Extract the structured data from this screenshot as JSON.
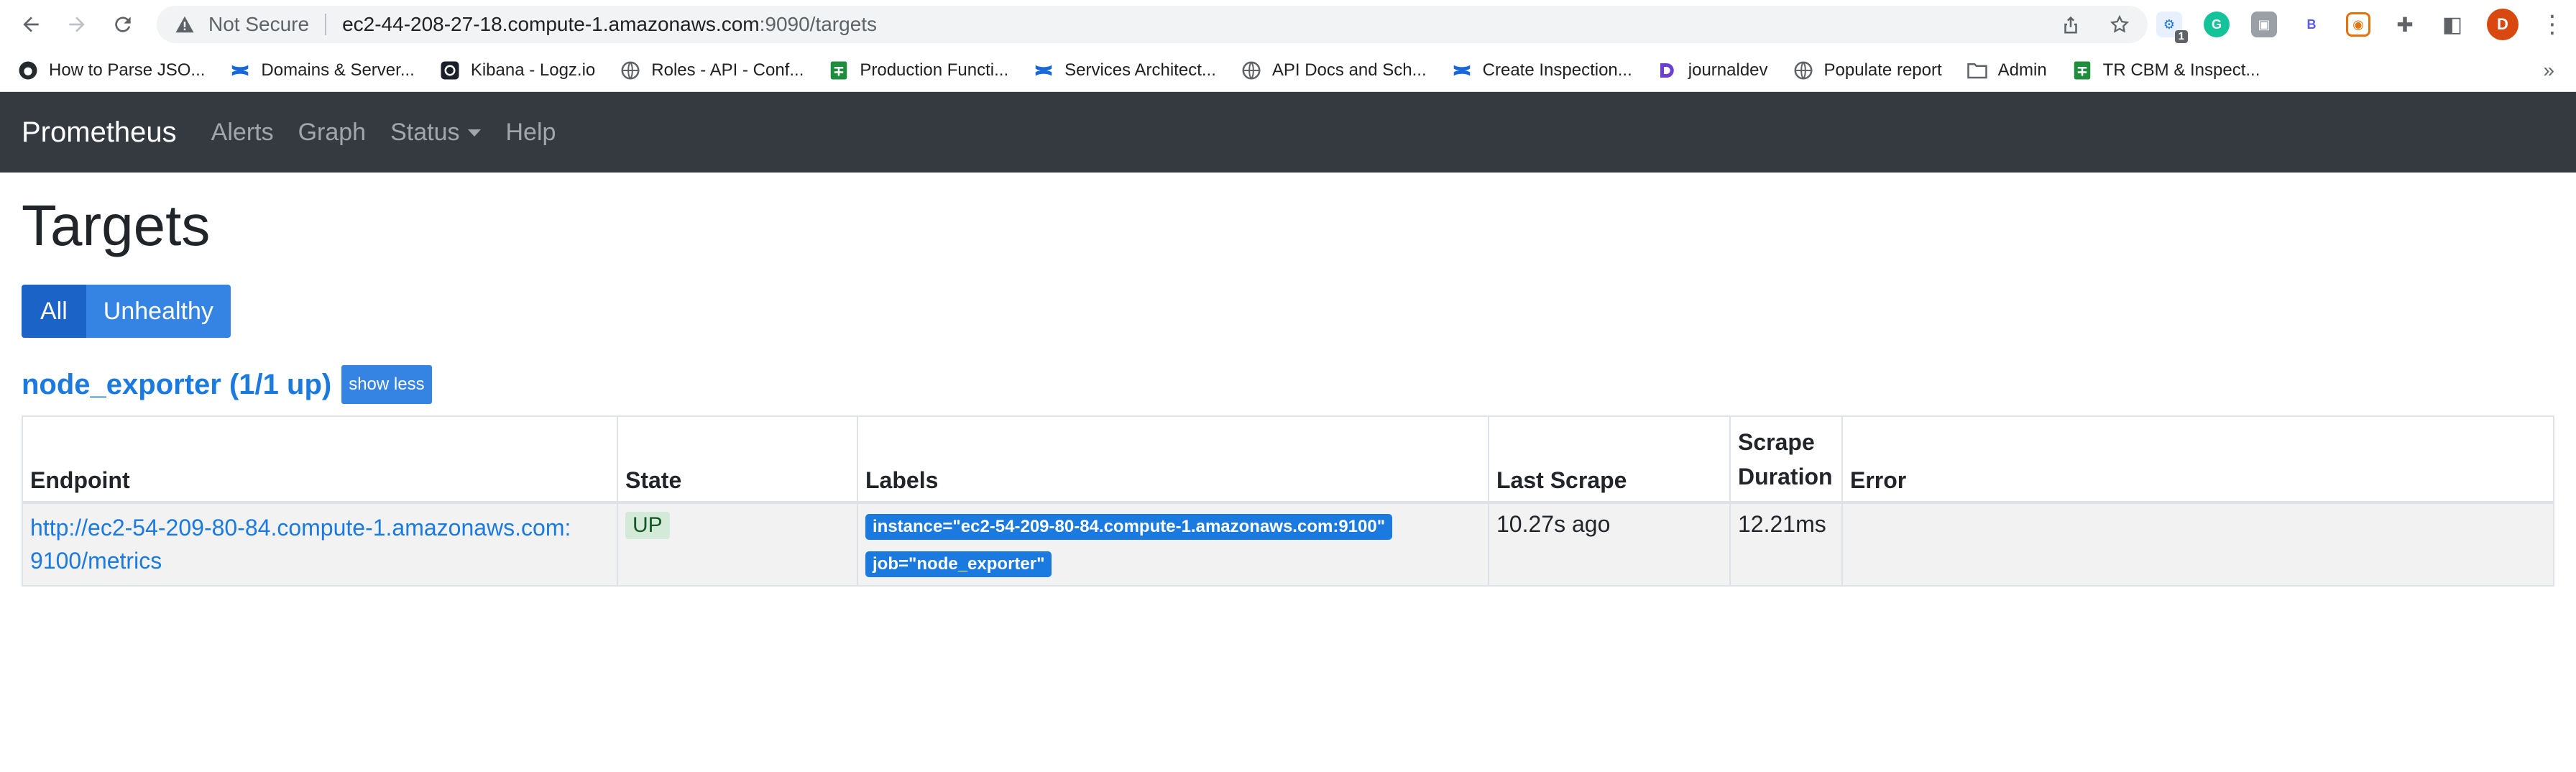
{
  "browser": {
    "security_label": "Not Secure",
    "url_host": "ec2-44-208-27-18.compute-1.amazonaws.com",
    "url_rest": ":9090/targets",
    "profile_initial": "D",
    "extension_badge": "1",
    "bookmarks": [
      {
        "label": "How to Parse JSO...",
        "icon": "github-icon"
      },
      {
        "label": "Domains & Server...",
        "icon": "confluence-icon"
      },
      {
        "label": "Kibana - Logz.io",
        "icon": "logzio-icon"
      },
      {
        "label": "Roles - API - Conf...",
        "icon": "globe-icon"
      },
      {
        "label": "Production Functi...",
        "icon": "sheets-icon"
      },
      {
        "label": "Services Architect...",
        "icon": "confluence-icon"
      },
      {
        "label": "API Docs and Sch...",
        "icon": "globe-icon"
      },
      {
        "label": "Create Inspection...",
        "icon": "confluence-icon"
      },
      {
        "label": "journaldev",
        "icon": "journaldev-icon"
      },
      {
        "label": "Populate report",
        "icon": "globe-icon"
      },
      {
        "label": "Admin",
        "icon": "folder-icon"
      },
      {
        "label": "TR CBM & Inspect...",
        "icon": "sheets-icon"
      }
    ],
    "more_label": "»"
  },
  "navbar": {
    "brand": "Prometheus",
    "links": [
      "Alerts",
      "Graph",
      "Status",
      "Help"
    ]
  },
  "page": {
    "title": "Targets",
    "filter_buttons": [
      "All",
      "Unhealthy"
    ],
    "job_title": "node_exporter (1/1 up)",
    "show_less": "show less"
  },
  "table": {
    "headers": {
      "endpoint": "Endpoint",
      "state": "State",
      "labels": "Labels",
      "last_scrape": "Last Scrape",
      "scrape_duration_1": "Scrape",
      "scrape_duration_2": "Duration",
      "error": "Error"
    },
    "rows": [
      {
        "endpoint_line1": "http://ec2-54-209-80-84.compute-1.amazonaws.com:",
        "endpoint_line2": "9100/metrics",
        "state": "UP",
        "labels": [
          "instance=\"ec2-54-209-80-84.compute-1.amazonaws.com:9100\"",
          "job=\"node_exporter\""
        ],
        "last_scrape": "10.27s ago",
        "scrape_duration": "12.21ms",
        "error": ""
      }
    ]
  },
  "colors": {
    "navbar": "#343a40",
    "link": "#1a7ae0",
    "button": "#3584e4",
    "button_active": "#1b63c6"
  }
}
